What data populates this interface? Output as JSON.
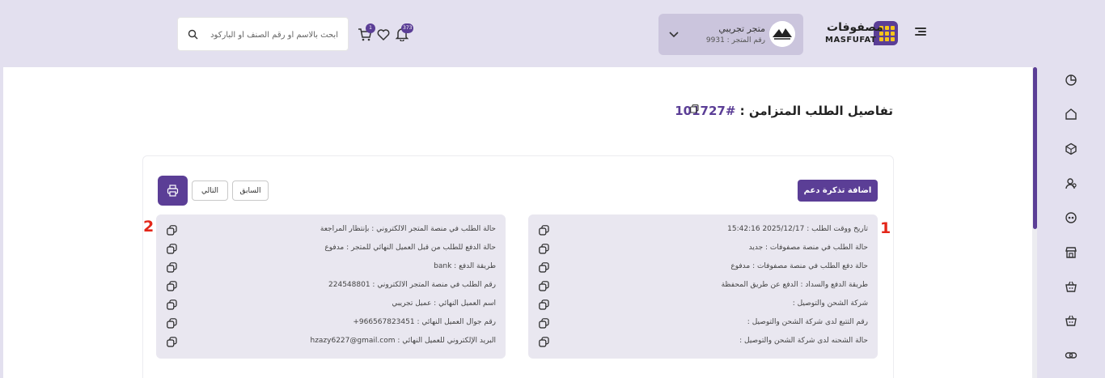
{
  "header": {
    "logo_ar": "مصفوفات",
    "logo_en": "MASFUFAT",
    "store_name": "متجر تجريبي",
    "store_number": "رقم المتجر : 9931",
    "cart_badge": "1",
    "notifications_badge": "373",
    "search_placeholder": "ابحث بالاسم أو رقم الصنف أو الباركود"
  },
  "page": {
    "title": "تفاصيل الطلب المتزامن : ",
    "order_number": "#101727"
  },
  "actions": {
    "add_ticket": "اضافة تذكرة دعم",
    "previous": "السابق",
    "next": "التالي"
  },
  "markers": {
    "one": "1",
    "two": "2"
  },
  "panel_1": [
    "تاريخ ووقت الطلب : 2025/12/17 15:42:16",
    "حالة الطلب في منصة مصفوفات : جديد",
    "حالة دفع الطلب في منصة مصفوفات : مدفوع",
    "طريقة الدفع والسداد : الدفع عن طريق المحفظة",
    "شركة الشحن والتوصيل :",
    "رقم التتبع لدى شركة الشحن والتوصيل :",
    "حالة الشحنه لدى شركة الشحن والتوصيل :"
  ],
  "panel_2": [
    "حالة الطلب في منصة المتجر الالكتروني : بإنتظار المراجعة",
    "حالة الدفع للطلب من قبل العميل النهائي للمتجر : مدفوع",
    "طريقة الدفع : bank",
    "رقم الطلب في منصة المتجر الالكتروني : 224548801",
    "اسم العميل النهائي : عميل تجريبي",
    "رقم جوال العميل النهائي : 966567823451+",
    "البريد الإلكتروني للعميل النهائي : hzazy6227@gmail.com"
  ],
  "sidebar_icons": [
    "chart-pie-icon",
    "home-icon",
    "box-icon",
    "users-icon",
    "coins-icon",
    "store-icon",
    "basket-icon",
    "basket-alt-icon",
    "link-icon"
  ],
  "colors": {
    "brand": "#5b3e96",
    "accent_yellow": "#f5c518",
    "marker_red": "#e32619",
    "header_bg": "#e3e0ef",
    "panel_bg": "#e9e7f0"
  },
  "scrollbar_position": 0.52
}
